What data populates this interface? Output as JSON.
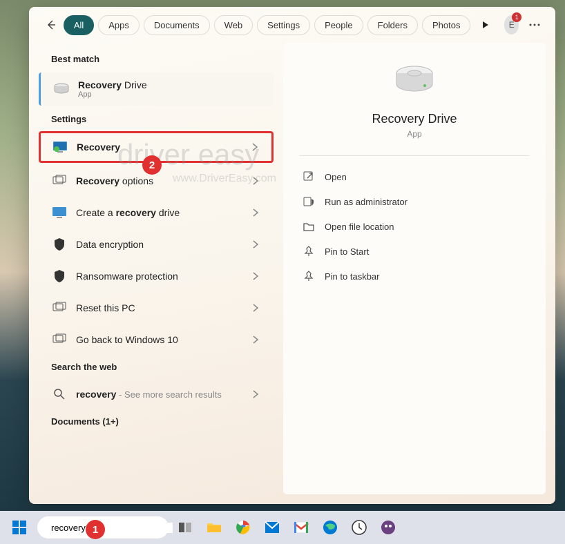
{
  "header": {
    "tabs": [
      "All",
      "Apps",
      "Documents",
      "Web",
      "Settings",
      "People",
      "Folders",
      "Photos"
    ],
    "active_tab": 0,
    "avatar_letter": "E",
    "avatar_badge": "1"
  },
  "sections": {
    "best_match_label": "Best match",
    "settings_label": "Settings",
    "web_label": "Search the web",
    "documents_label": "Documents (1+)"
  },
  "best_match": {
    "title_pre": "Recovery",
    "title_post": " Drive",
    "subtitle": "App"
  },
  "settings_items": [
    {
      "pre": "",
      "bold": "Recovery",
      "post": ""
    },
    {
      "pre": "",
      "bold": "Recovery",
      "post": " options"
    },
    {
      "pre": "Create a ",
      "bold": "recovery",
      "post": " drive"
    },
    {
      "pre": "Data encryption",
      "bold": "",
      "post": ""
    },
    {
      "pre": "Ransomware protection",
      "bold": "",
      "post": ""
    },
    {
      "pre": "Reset this PC",
      "bold": "",
      "post": ""
    },
    {
      "pre": "Go back to Windows 10",
      "bold": "",
      "post": ""
    }
  ],
  "web_item": {
    "pre": "",
    "bold": "recovery",
    "post": " - See more search results"
  },
  "preview": {
    "title": "Recovery Drive",
    "subtitle": "App",
    "actions": [
      "Open",
      "Run as administrator",
      "Open file location",
      "Pin to Start",
      "Pin to taskbar"
    ]
  },
  "taskbar": {
    "search_value": "recovery"
  },
  "annotations": {
    "one": "1",
    "two": "2"
  },
  "watermark": {
    "main": "driver easy",
    "url": "www.DriverEasy.com"
  }
}
